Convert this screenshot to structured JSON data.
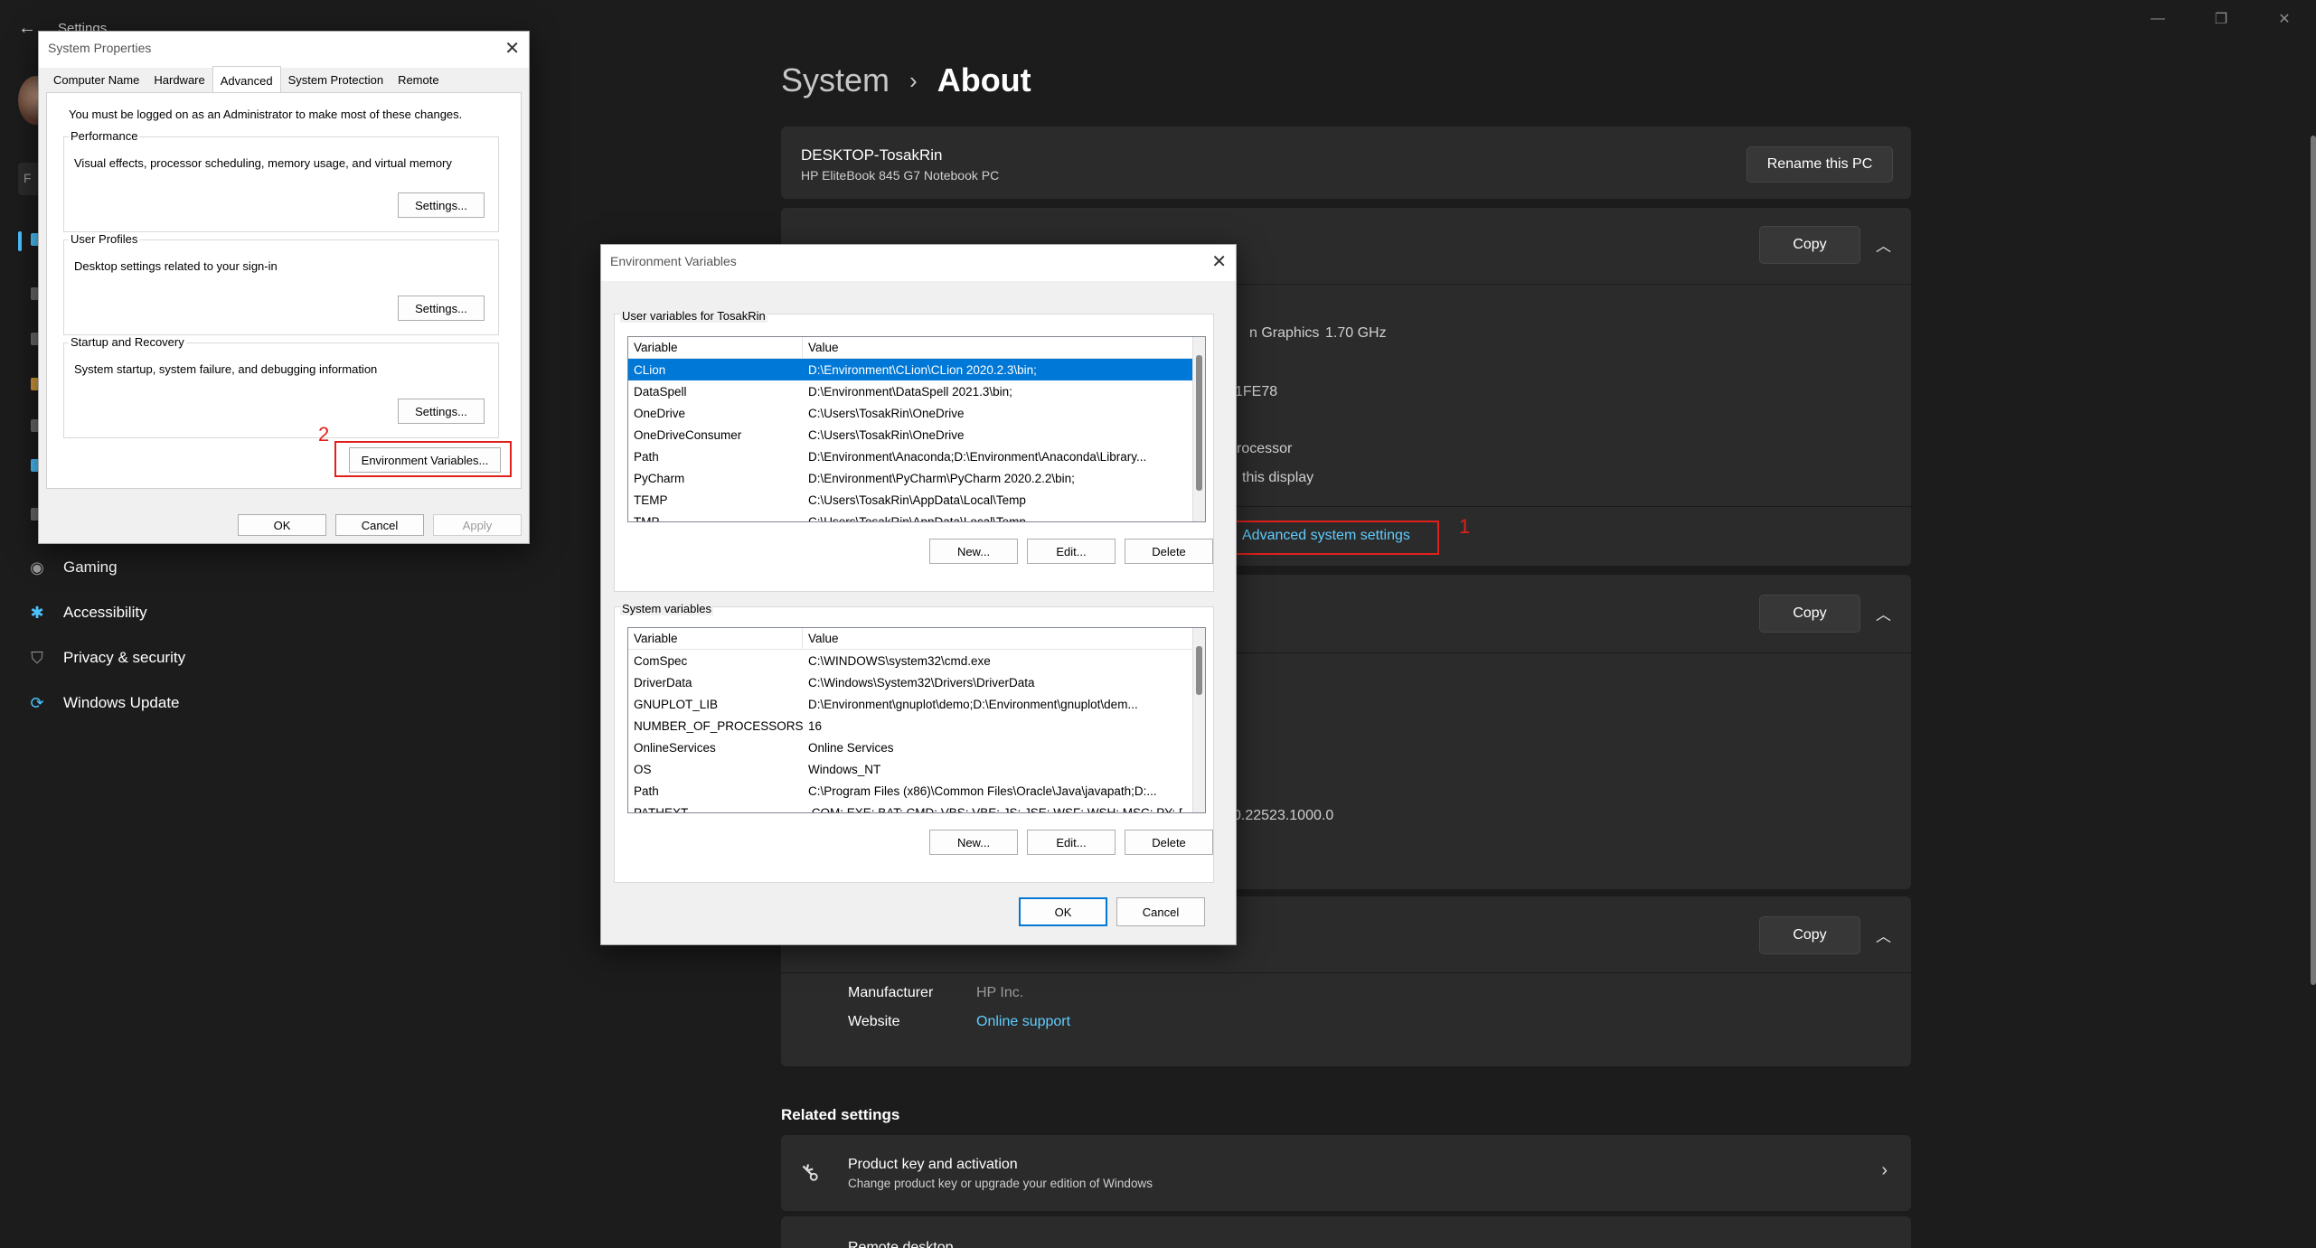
{
  "settings": {
    "window_title": "Settings",
    "breadcrumb_parent": "System",
    "breadcrumb_sep": "›",
    "breadcrumb_current": "About",
    "nav": [
      {
        "label": "Gaming",
        "icon": "gamepad-icon",
        "glyph": "◉",
        "color": "#9a9a9a"
      },
      {
        "label": "Accessibility",
        "icon": "accessibility-icon",
        "glyph": "✱",
        "color": "#4cc2ff"
      },
      {
        "label": "Privacy & security",
        "icon": "shield-icon",
        "glyph": "⛉",
        "color": "#9a9a9a"
      },
      {
        "label": "Windows Update",
        "icon": "update-icon",
        "glyph": "⟳",
        "color": "#4cc2ff"
      }
    ],
    "device_card": {
      "name": "DESKTOP-TosakRin",
      "model": "HP EliteBook 845 G7 Notebook PC",
      "rename_button": "Rename this PC"
    },
    "device_specs": {
      "copy_button": "Copy",
      "frag_graphics": "n Graphics",
      "frag_speed": "1.70 GHz",
      "frag_id": "1FE78",
      "frag_processor": "rocessor",
      "frag_display": "this display",
      "advanced_link": "Advanced system settings"
    },
    "windows_specs": {
      "copy_button": "Copy",
      "frag_build": "0.22523.1000.0"
    },
    "support": {
      "copy_button": "Copy",
      "manufacturer_label": "Manufacturer",
      "manufacturer_value": "HP Inc.",
      "website_label": "Website",
      "website_value": "Online support"
    },
    "related": {
      "title": "Related settings",
      "items": [
        {
          "title": "Product key and activation",
          "subtitle": "Change product key or upgrade your edition of Windows"
        },
        {
          "title": "Remote desktop",
          "subtitle": ""
        }
      ]
    },
    "annotations": {
      "mark1": "1",
      "mark2": "2"
    }
  },
  "system_properties": {
    "title": "System Properties",
    "tabs": [
      "Computer Name",
      "Hardware",
      "Advanced",
      "System Protection",
      "Remote"
    ],
    "active_tab": "Advanced",
    "admin_note": "You must be logged on as an Administrator to make most of these changes.",
    "performance": {
      "label": "Performance",
      "text": "Visual effects, processor scheduling, memory usage, and virtual memory",
      "button": "Settings..."
    },
    "user_profiles": {
      "label": "User Profiles",
      "text": "Desktop settings related to your sign-in",
      "button": "Settings..."
    },
    "startup": {
      "label": "Startup and Recovery",
      "text": "System startup, system failure, and debugging information",
      "button": "Settings..."
    },
    "env_button": "Environment Variables...",
    "ok": "OK",
    "cancel": "Cancel",
    "apply": "Apply"
  },
  "env_vars": {
    "title": "Environment Variables",
    "user_group": "User variables for TosakRin",
    "system_group": "System variables",
    "col_variable": "Variable",
    "col_value": "Value",
    "user_rows": [
      {
        "name": "CLion",
        "value": "D:\\Environment\\CLion\\CLion 2020.2.3\\bin;",
        "selected": true
      },
      {
        "name": "DataSpell",
        "value": "D:\\Environment\\DataSpell 2021.3\\bin;"
      },
      {
        "name": "OneDrive",
        "value": "C:\\Users\\TosakRin\\OneDrive"
      },
      {
        "name": "OneDriveConsumer",
        "value": "C:\\Users\\TosakRin\\OneDrive"
      },
      {
        "name": "Path",
        "value": "D:\\Environment\\Anaconda;D:\\Environment\\Anaconda\\Library..."
      },
      {
        "name": "PyCharm",
        "value": "D:\\Environment\\PyCharm\\PyCharm 2020.2.2\\bin;"
      },
      {
        "name": "TEMP",
        "value": "C:\\Users\\TosakRin\\AppData\\Local\\Temp"
      },
      {
        "name": "TMP",
        "value": "C:\\Users\\TosakRin\\AppData\\Local\\Temp"
      }
    ],
    "system_rows": [
      {
        "name": "ComSpec",
        "value": "C:\\WINDOWS\\system32\\cmd.exe"
      },
      {
        "name": "DriverData",
        "value": "C:\\Windows\\System32\\Drivers\\DriverData"
      },
      {
        "name": "GNUPLOT_LIB",
        "value": "D:\\Environment\\gnuplot\\demo;D:\\Environment\\gnuplot\\dem..."
      },
      {
        "name": "NUMBER_OF_PROCESSORS",
        "value": "16"
      },
      {
        "name": "OnlineServices",
        "value": "Online Services"
      },
      {
        "name": "OS",
        "value": "Windows_NT"
      },
      {
        "name": "Path",
        "value": "C:\\Program Files (x86)\\Common Files\\Oracle\\Java\\javapath;D:..."
      },
      {
        "name": "PATHEXT",
        "value": ".COM;.EXE;.BAT;.CMD;.VBS;.VBE;.JS;.JSE;.WSF;.WSH;.MSC;.PY;.PYW"
      }
    ],
    "new": "New...",
    "edit": "Edit...",
    "delete": "Delete",
    "ok": "OK",
    "cancel": "Cancel"
  }
}
